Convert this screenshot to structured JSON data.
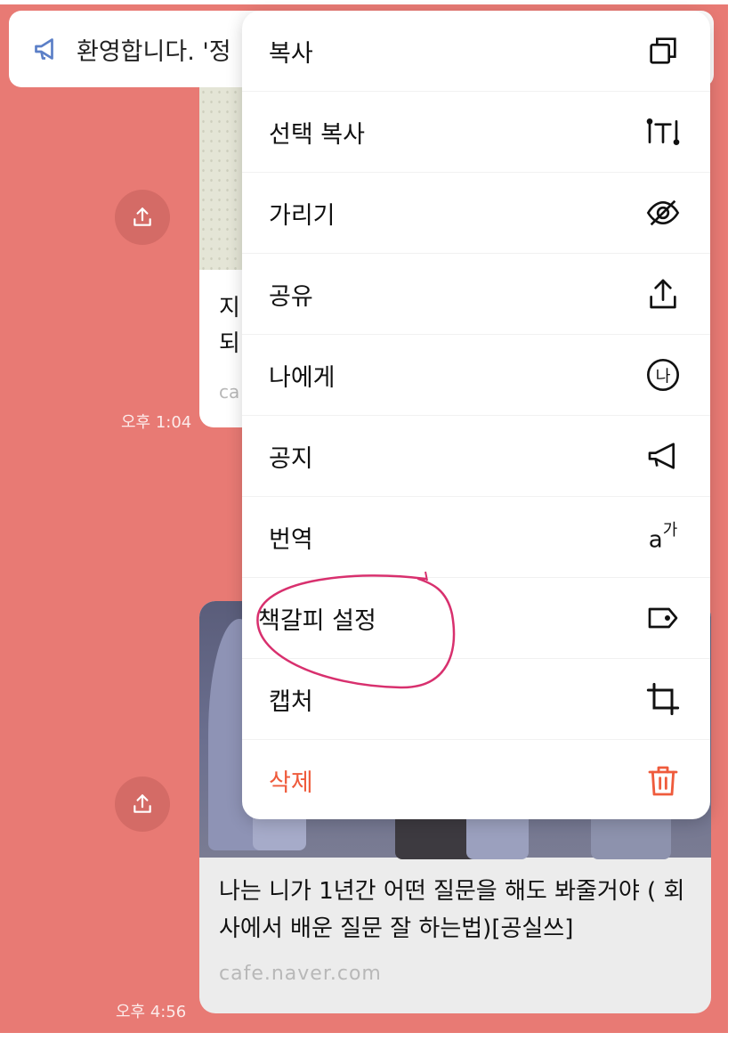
{
  "notice": {
    "icon": "megaphone-icon",
    "text": "환영합니다. '정"
  },
  "messages": [
    {
      "title_lines": [
        "지",
        "되"
      ],
      "domain": "ca",
      "time": "오후 1:04"
    },
    {
      "title": "나는 니가 1년간 어떤 질문을 해도 봐줄거야 ( 회사에서 배운 질문 잘 하는법)[공실쓰]",
      "domain": "cafe.naver.com",
      "time": "오후 4:56"
    }
  ],
  "context_menu": {
    "items": [
      {
        "label": "복사",
        "icon": "copy-icon"
      },
      {
        "label": "선택 복사",
        "icon": "text-select-icon"
      },
      {
        "label": "가리기",
        "icon": "eye-off-icon"
      },
      {
        "label": "공유",
        "icon": "share-icon"
      },
      {
        "label": "나에게",
        "icon": "me-circle-icon",
        "icon_text": "나"
      },
      {
        "label": "공지",
        "icon": "megaphone-icon"
      },
      {
        "label": "번역",
        "icon": "translate-icon",
        "icon_text": "a",
        "icon_sup": "가"
      },
      {
        "label": "책갈피 설정",
        "icon": "bookmark-tag-icon",
        "highlighted": true
      },
      {
        "label": "캡처",
        "icon": "crop-icon"
      },
      {
        "label": "삭제",
        "icon": "trash-icon",
        "danger": true
      }
    ]
  },
  "colors": {
    "chat_background": "#e87a74",
    "danger": "#ef5b3c",
    "annotation": "#d8306e"
  }
}
